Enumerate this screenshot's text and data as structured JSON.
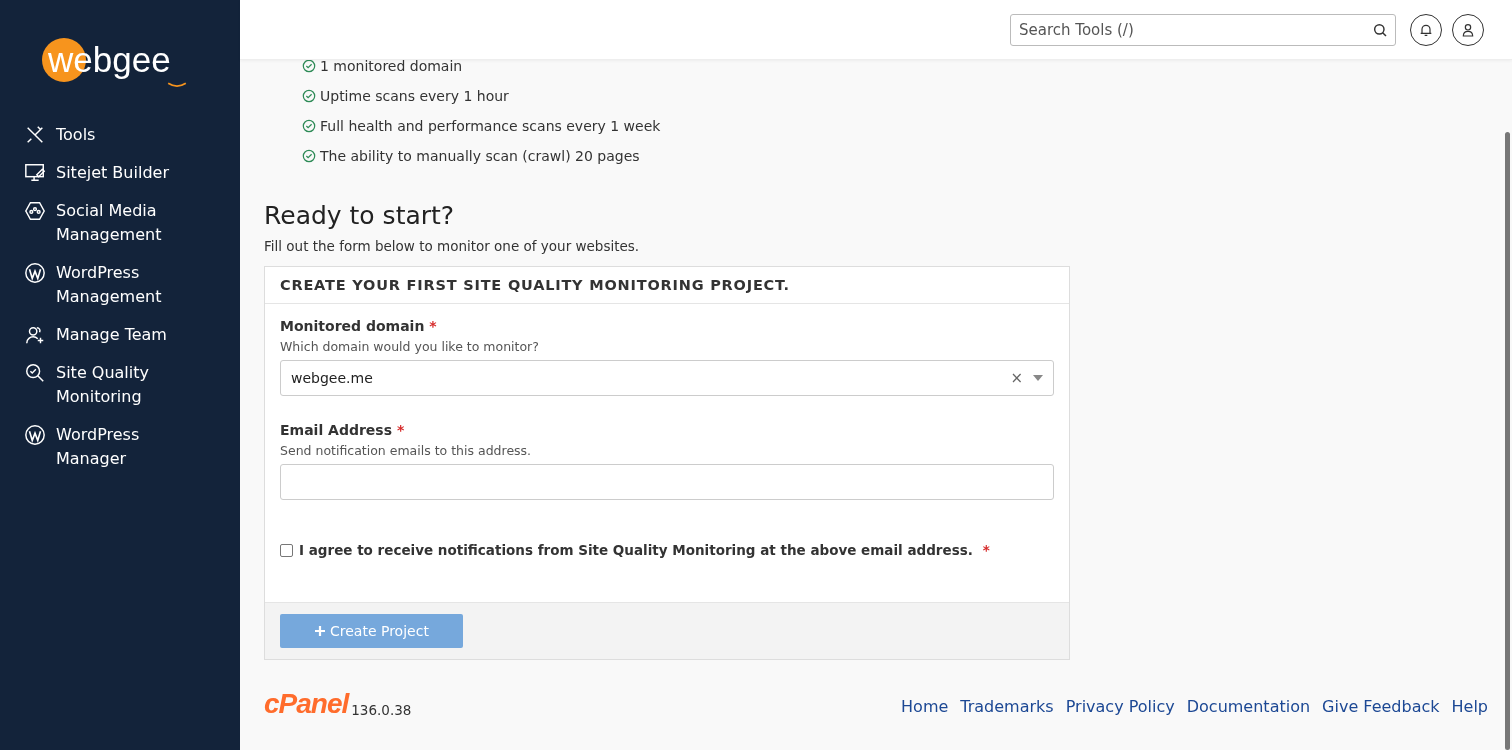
{
  "logo": {
    "text": "webgee"
  },
  "sidebar": {
    "items": [
      {
        "label": "Tools",
        "kind": "tools"
      },
      {
        "label": "Sitejet Builder",
        "kind": "monitor"
      },
      {
        "label": "Social Media Management",
        "kind": "social"
      },
      {
        "label": "WordPress Management",
        "kind": "wordpress"
      },
      {
        "label": "Manage Team",
        "kind": "team"
      },
      {
        "label": "Site Quality Monitoring",
        "kind": "quality"
      },
      {
        "label": "WordPress Manager",
        "kind": "wordpress"
      }
    ]
  },
  "header": {
    "search": {
      "placeholder": "Search Tools (/)"
    }
  },
  "features": [
    "1 monitored domain",
    "Uptime scans every 1 hour",
    "Full health and performance scans every 1 week",
    "The ability to manually scan (crawl) 20 pages"
  ],
  "heading": "Ready to start?",
  "intro": "Fill out the form below to monitor one of your websites.",
  "form": {
    "title": "CREATE YOUR FIRST SITE QUALITY MONITORING PROJECT.",
    "fields": [
      {
        "kind": "select",
        "label": "Monitored domain",
        "required_mark": "*",
        "help": "Which domain would you like to monitor?",
        "value": "webgee.me",
        "clear": "×"
      },
      {
        "kind": "text",
        "label": "Email Address",
        "required_mark": "*",
        "help": "Send notification emails to this address."
      }
    ],
    "agree": {
      "label": "I agree to receive notifications from Site Quality Monitoring at the above email address.",
      "required_mark": "*",
      "checked": false
    },
    "submit": {
      "label": "Create Project",
      "disabled": true
    }
  },
  "footer": {
    "brand": "cPanel",
    "version": "136.0.38",
    "links": [
      "Home",
      "Trademarks",
      "Privacy Policy",
      "Documentation",
      "Give Feedback",
      "Help"
    ]
  }
}
